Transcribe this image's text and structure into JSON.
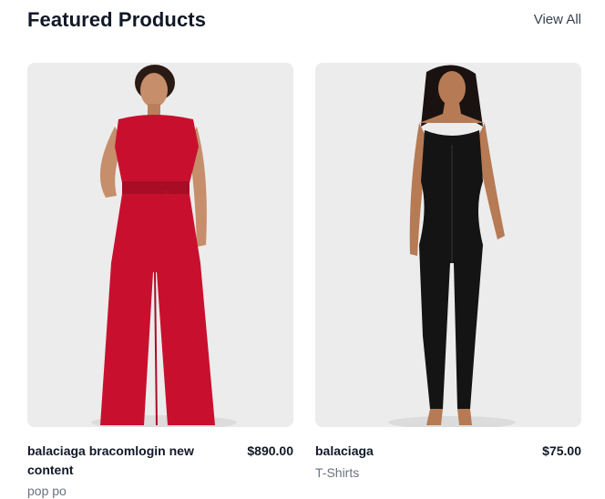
{
  "section": {
    "title": "Featured Products",
    "view_all_label": "View All"
  },
  "products": [
    {
      "name": "balaciaga bracomlogin new content",
      "price": "$890.00",
      "category": "pop po",
      "image": "model-red-jumpsuit"
    },
    {
      "name": "balaciaga",
      "price": "$75.00",
      "category": "T-Shirts",
      "image": "model-black-jumpsuit"
    }
  ],
  "colors": {
    "image_bg": "#ececec",
    "title": "#111827",
    "muted": "#6b7280",
    "garment_red": "#c8102e",
    "garment_black": "#141414",
    "skin": "#c68e6b"
  }
}
